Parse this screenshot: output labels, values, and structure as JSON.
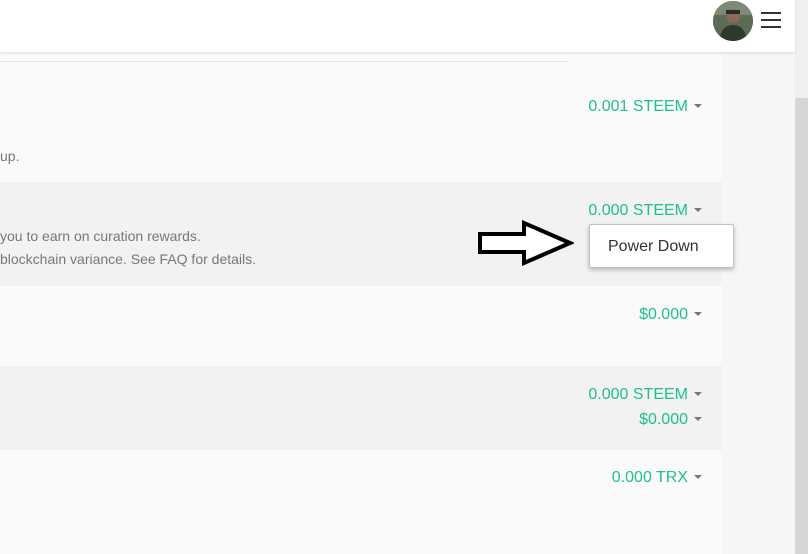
{
  "rows": [
    {
      "value": "0.001 STEEM",
      "desc_lines": [
        "up."
      ]
    },
    {
      "value": "0.000 STEEM",
      "desc_lines": [
        "you to earn on curation rewards.",
        "blockchain variance. See FAQ for details."
      ]
    },
    {
      "value": "$0.000"
    },
    {
      "values": [
        "0.000 STEEM",
        "$0.000"
      ]
    },
    {
      "value": "0.000 TRX"
    }
  ],
  "dropdown": {
    "items": [
      "Power Down"
    ]
  },
  "colors": {
    "accent": "#1fbf8f",
    "text_muted": "#777777"
  },
  "icons": {
    "menu": "hamburger-menu-icon",
    "caret": "caret-down-icon",
    "arrow": "right-arrow-annotation"
  }
}
